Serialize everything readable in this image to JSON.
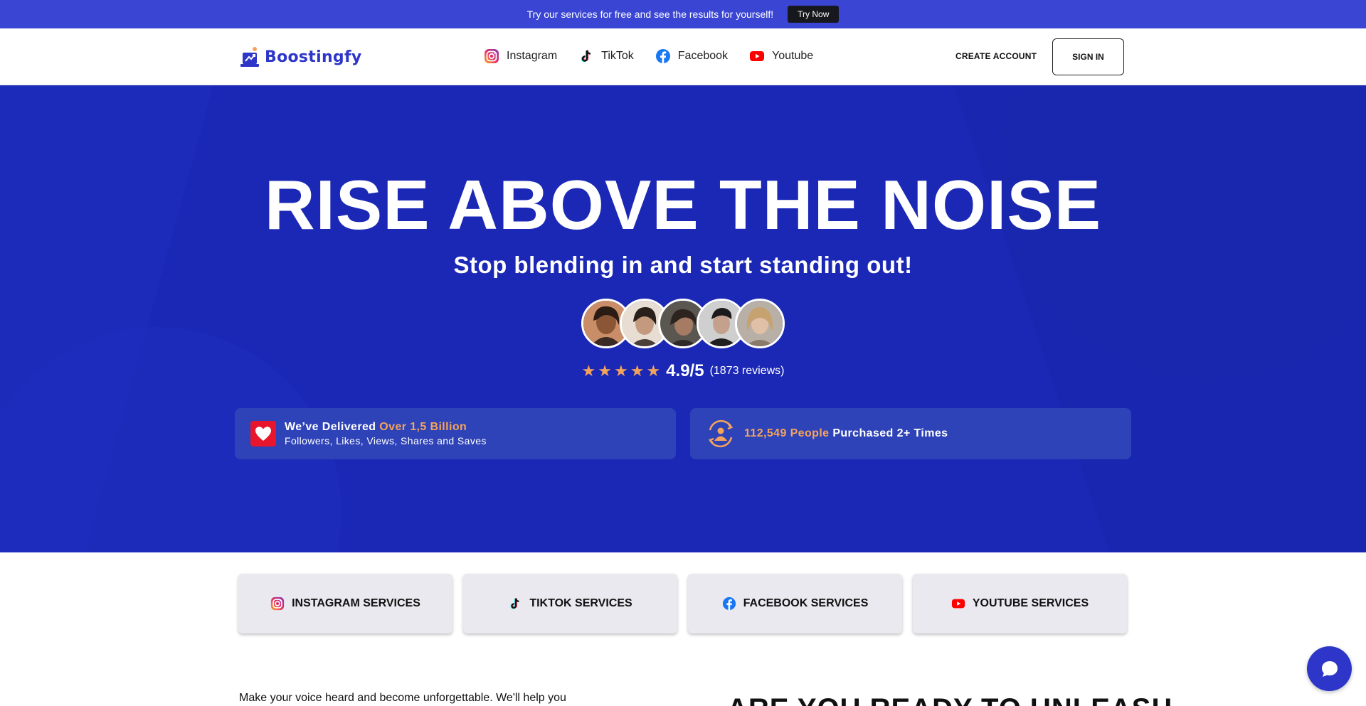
{
  "promo": {
    "text": "Try our services for free and see the results for yourself!",
    "button": "Try Now"
  },
  "header": {
    "logo_text": "Boostingfy",
    "nav": [
      {
        "label": "Instagram",
        "icon": "instagram-icon"
      },
      {
        "label": "TikTok",
        "icon": "tiktok-icon"
      },
      {
        "label": "Facebook",
        "icon": "facebook-icon"
      },
      {
        "label": "Youtube",
        "icon": "youtube-icon"
      }
    ],
    "create_account": "CREATE ACCOUNT",
    "sign_in": "SIGN IN"
  },
  "hero": {
    "title": "RISE ABOVE THE NOISE",
    "subtitle": "Stop blending in and start standing out!",
    "rating_value": "4.9/5",
    "rating_count": "(1873 reviews)",
    "stars": 5,
    "stat_left": {
      "prefix": "We’ve Delivered ",
      "highlight": "Over 1,5 Billion",
      "line2": "Followers, Likes, Views, Shares and Saves"
    },
    "stat_right": {
      "highlight": "112,549 People",
      "suffix": " Purchased 2+ Times"
    }
  },
  "services": [
    {
      "label": "INSTAGRAM SERVICES",
      "icon": "instagram-icon"
    },
    {
      "label": "TIKTOK SERVICES",
      "icon": "tiktok-icon"
    },
    {
      "label": "FACEBOOK SERVICES",
      "icon": "facebook-icon"
    },
    {
      "label": "YOUTUBE SERVICES",
      "icon": "youtube-icon"
    }
  ],
  "below": {
    "paragraph": "Make your voice heard and become unforgettable. We'll help you",
    "heading": "ARE YOU READY TO UNLEASH"
  },
  "colors": {
    "promo_bg": "#3a45d4",
    "hero_bg": "#1c2ab8",
    "accent_orange": "#f5a35a",
    "brand_blue": "#2d36c8"
  }
}
